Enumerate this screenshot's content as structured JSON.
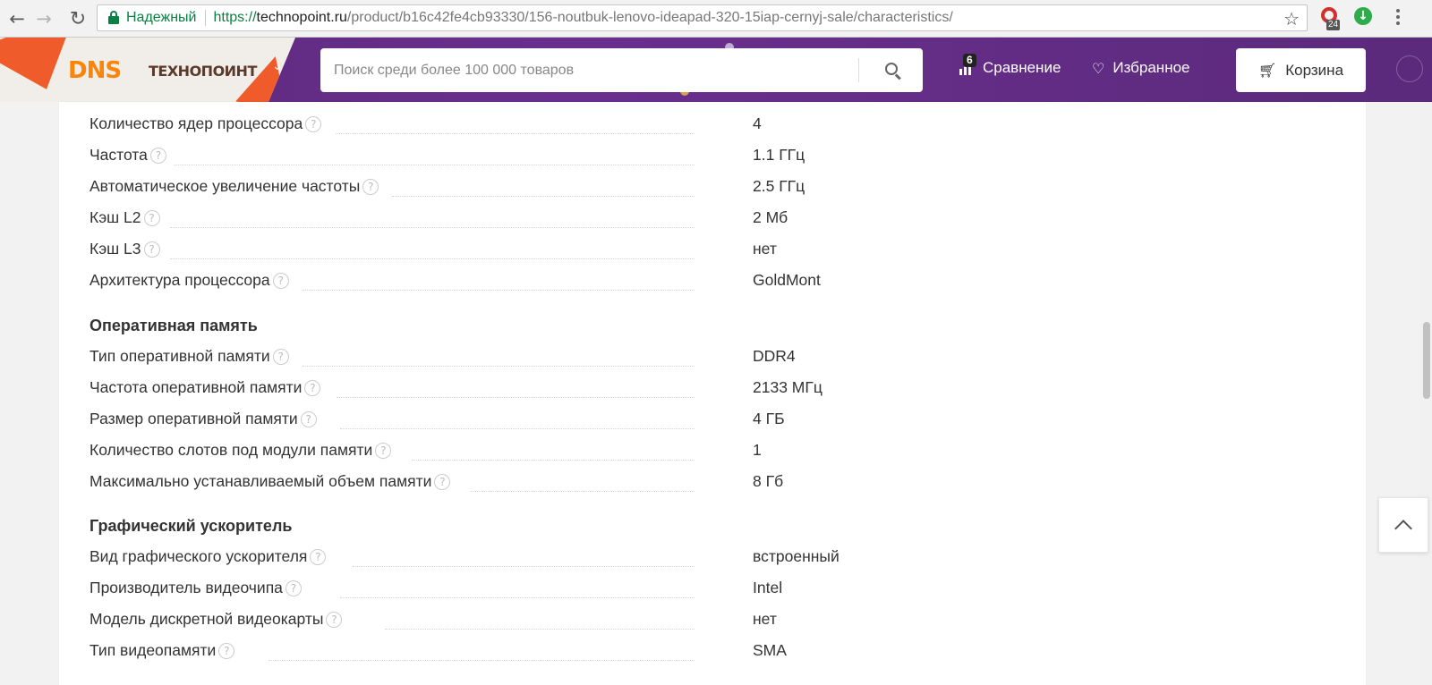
{
  "browser": {
    "secure_label": "Надежный",
    "url_scheme": "https://",
    "url_host": "technopoint.ru",
    "url_path": "/product/b16c42fe4cb93330/156-noutbuk-lenovo-ideapad-320-15iap-cernyj-sale/characteristics/",
    "extension_badge": "24"
  },
  "header": {
    "logo_dns": "DNS",
    "logo_tech": "ТЕХНОПОИНТ",
    "search_placeholder": "Поиск среди более 100 000 товаров",
    "compare_label": "Сравнение",
    "compare_count": "6",
    "favorites_label": "Избранное",
    "cart_label": "Корзина"
  },
  "specs": {
    "cpu_rows": [
      {
        "name": "Количество ядер процессора",
        "value": "4"
      },
      {
        "name": "Частота",
        "value": "1.1 ГГц"
      },
      {
        "name": "Автоматическое увеличение частоты",
        "value": "2.5 ГГц"
      },
      {
        "name": "Кэш L2",
        "value": "2 Мб"
      },
      {
        "name": "Кэш L3",
        "value": "нет"
      },
      {
        "name": "Архитектура процессора",
        "value": "GoldMont"
      }
    ],
    "ram_title": "Оперативная память",
    "ram_rows": [
      {
        "name": "Тип оперативной памяти",
        "value": "DDR4"
      },
      {
        "name": "Частота оперативной памяти",
        "value": "2133 МГц"
      },
      {
        "name": "Размер оперативной памяти",
        "value": "4 ГБ"
      },
      {
        "name": "Количество слотов под модули памяти",
        "value": "1"
      },
      {
        "name": "Максимально устанавливаемый объем памяти",
        "value": "8 Гб"
      }
    ],
    "gpu_title": "Графический ускоритель",
    "gpu_rows": [
      {
        "name": "Вид графического ускорителя",
        "value": "встроенный"
      },
      {
        "name": "Производитель видеочипа",
        "value": "Intel"
      },
      {
        "name": "Модель дискретной видеокарты",
        "value": "нет"
      },
      {
        "name": "Тип видеопамяти",
        "value": "SMA"
      }
    ]
  },
  "icons": {
    "help": "?"
  }
}
